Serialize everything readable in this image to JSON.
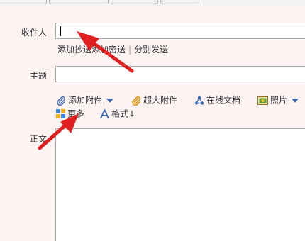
{
  "form": {
    "recipient": {
      "label": "收件人",
      "value": ""
    },
    "recipient_links": {
      "cc": "添加抄送",
      "bcc": "添加密送",
      "separator": "|",
      "separate_send": "分别发送"
    },
    "subject": {
      "label": "主题",
      "value": ""
    },
    "toolbar": {
      "add_attachment": {
        "label": "添加附件",
        "icon": "paperclip-icon"
      },
      "large_attachment": {
        "label": "超大附件",
        "icon": "paperclip-large-icon"
      },
      "online_docs": {
        "label": "在线文档",
        "icon": "share-nodes-icon"
      },
      "photo": {
        "label": "照片",
        "icon": "photo-icon"
      },
      "more": {
        "label": "更多",
        "icon": "grid-icon"
      },
      "format": {
        "label": "格式↓",
        "icon": "font-a-icon"
      }
    },
    "body": {
      "label": "正文",
      "value": ""
    }
  },
  "colors": {
    "background": "#fdf3f3",
    "arrow": "#e02020",
    "dropdown_arrow": "#3a68b5"
  }
}
